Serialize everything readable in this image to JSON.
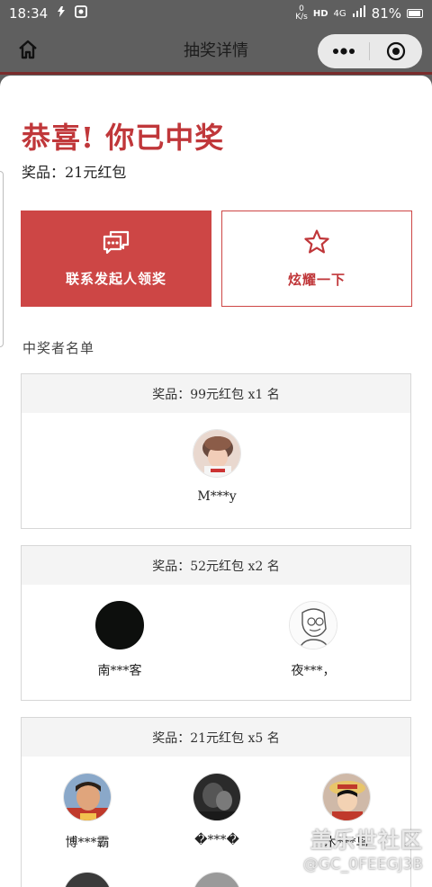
{
  "status_bar": {
    "time": "18:34",
    "net_speed_top": "0",
    "net_speed_unit": "K/s",
    "hd": "HD",
    "net_type": "4G",
    "battery": "81%"
  },
  "nav": {
    "title": "抽奖详情",
    "icons": [
      "home-icon",
      "more-dots-icon",
      "close-target-icon"
    ]
  },
  "result": {
    "title": "恭喜! 你已中奖",
    "prize": "奖品：21元红包"
  },
  "actions": {
    "contact_label": "联系发起人领奖",
    "share_label": "炫耀一下",
    "contact_icon": "chat-bubbles-icon",
    "share_icon": "star-outline-icon"
  },
  "winners": {
    "heading": "中奖者名单",
    "groups": [
      {
        "title": "奖品：99元红包 x1 名",
        "people": [
          "M***y"
        ]
      },
      {
        "title": "奖品：52元红包 x2 名",
        "people": [
          "南***客",
          "夜***，"
        ]
      },
      {
        "title": "奖品：21元红包 x5 名",
        "people": [
          "博***霸",
          "�***�",
          "木***鸟"
        ]
      }
    ]
  },
  "watermark": {
    "line1": "盖乐世社区",
    "line2": "@GC_0FEEGJ3B"
  },
  "colors": {
    "accent": "#cd4645",
    "title_red": "#c0373a",
    "nav_bg": "#5f5f5f"
  }
}
